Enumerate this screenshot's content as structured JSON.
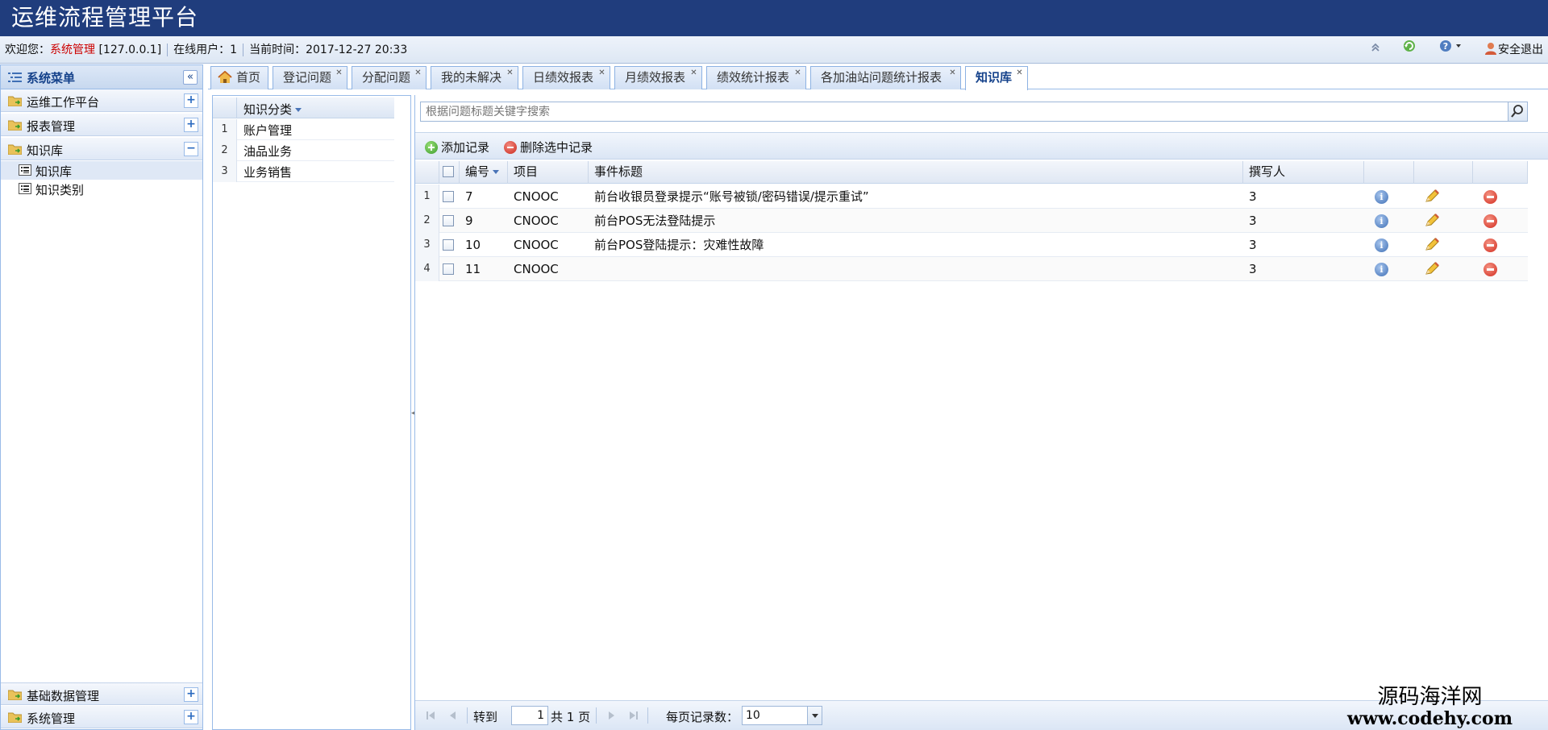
{
  "app": {
    "title": "运维流程管理平台"
  },
  "status": {
    "welcome": "欢迎您：",
    "user": "系统管理",
    "ip": "[127.0.0.1]",
    "online": "在线用户：1",
    "time": "当前时间：2017-12-27 20:33",
    "logout": "安全退出"
  },
  "sidebar": {
    "title": "系统菜单",
    "menus": [
      {
        "label": "运维工作平台",
        "toggle": "+"
      },
      {
        "label": "报表管理",
        "toggle": "+"
      },
      {
        "label": "知识库",
        "toggle": "−"
      }
    ],
    "sub_items": [
      {
        "label": "知识库"
      },
      {
        "label": "知识类别"
      }
    ],
    "bottom_menus": [
      {
        "label": "基础数据管理",
        "toggle": "+"
      },
      {
        "label": "系统管理",
        "toggle": "+"
      }
    ]
  },
  "tabs": [
    {
      "label": "首页"
    },
    {
      "label": "登记问题"
    },
    {
      "label": "分配问题"
    },
    {
      "label": "我的未解决"
    },
    {
      "label": "日绩效报表"
    },
    {
      "label": "月绩效报表"
    },
    {
      "label": "绩效统计报表"
    },
    {
      "label": "各加油站问题统计报表"
    },
    {
      "label": "知识库"
    }
  ],
  "category_grid": {
    "header": "知识分类",
    "rows": [
      {
        "num": "1",
        "name": "账户管理"
      },
      {
        "num": "2",
        "name": "油品业务"
      },
      {
        "num": "3",
        "name": "业务销售"
      }
    ]
  },
  "search": {
    "placeholder": "根据问题标题关键字搜索"
  },
  "toolbar": {
    "add": "添加记录",
    "delete": "删除选中记录"
  },
  "grid": {
    "columns": {
      "id": "编号",
      "project": "项目",
      "title": "事件标题",
      "author": "撰写人"
    },
    "rows": [
      {
        "num": "1",
        "id": "7",
        "project": "CNOOC",
        "title": "前台收银员登录提示“账号被锁/密码错误/提示重试”",
        "author": "3"
      },
      {
        "num": "2",
        "id": "9",
        "project": "CNOOC",
        "title": "前台POS无法登陆提示",
        "author": "3"
      },
      {
        "num": "3",
        "id": "10",
        "project": "CNOOC",
        "title": "前台POS登陆提示：灾难性故障",
        "author": "3"
      },
      {
        "num": "4",
        "id": "11",
        "project": "CNOOC",
        "title": "",
        "author": "3"
      }
    ]
  },
  "pager": {
    "goto": "转到",
    "page_value": "1",
    "total": "共 1 页",
    "per_page": "每页记录数：",
    "per_page_value": "10"
  },
  "watermark": {
    "cn": "源码海洋网",
    "en": "www.codehy.com"
  }
}
